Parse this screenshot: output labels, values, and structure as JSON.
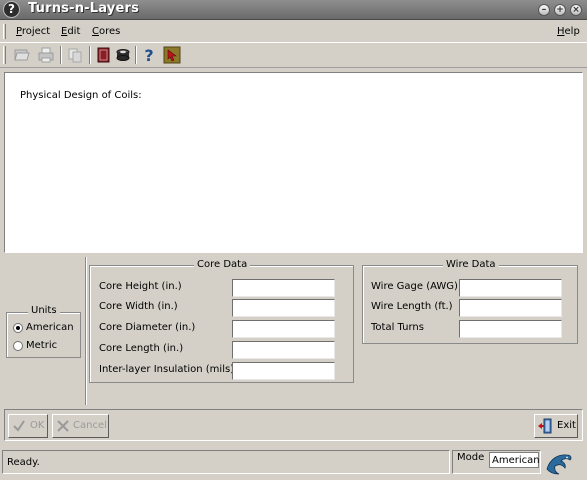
{
  "window": {
    "title": "Turns-n-Layers",
    "title_icon": "question-mark-icon"
  },
  "menu": {
    "items": [
      {
        "label": "Project"
      },
      {
        "label": "Edit"
      },
      {
        "label": "Cores"
      }
    ],
    "help": "Help"
  },
  "toolbar": {
    "icons": [
      "file-open-icon",
      "print-icon",
      "copy-icon",
      "book-icon",
      "core-icon",
      "help-icon",
      "cursor-icon"
    ]
  },
  "description": {
    "text": "Physical Design of Coils:"
  },
  "units": {
    "title": "Units",
    "options": [
      {
        "label": "American",
        "selected": true
      },
      {
        "label": "Metric",
        "selected": false
      }
    ]
  },
  "core_data": {
    "title": "Core Data",
    "fields": [
      {
        "label": "Core Height (in.)",
        "value": ""
      },
      {
        "label": "Core Width (in.)",
        "value": ""
      },
      {
        "label": "Core Diameter (in.)",
        "value": ""
      },
      {
        "label": "Core Length (in.)",
        "value": ""
      },
      {
        "label": "Inter-layer Insulation (mils)",
        "value": ""
      }
    ]
  },
  "wire_data": {
    "title": "Wire Data",
    "fields": [
      {
        "label": "Wire Gage (AWG)",
        "value": ""
      },
      {
        "label": "Wire Length (ft.)",
        "value": ""
      },
      {
        "label": "Total Turns",
        "value": ""
      }
    ]
  },
  "buttons": {
    "ok": "OK",
    "cancel": "Cancel",
    "exit": "Exit"
  },
  "status": {
    "text": "Ready.",
    "mode_label": "Mode",
    "mode_value": "American"
  },
  "colors": {
    "accent": "#1f4f8f",
    "disabled_text": "#9a9a9a",
    "panel": "#d4d0c8"
  }
}
